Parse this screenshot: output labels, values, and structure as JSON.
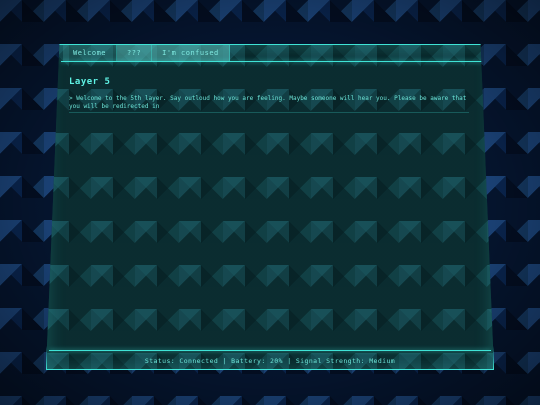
{
  "tabs": [
    {
      "label": "Welcome",
      "active": false
    },
    {
      "label": "???",
      "active": true
    },
    {
      "label": "I'm confused",
      "active": true
    }
  ],
  "main": {
    "heading": "Layer 5",
    "message": "> Welcome to the 5th layer. Say outloud how you are feeling. Maybe someone will hear you. Please be aware that you will be redirected in"
  },
  "status": {
    "text": "Status: Connected | Battery: 20% | Signal Strength: Medium"
  },
  "colors": {
    "accent": "#3fe3d6",
    "text": "#6ee7da",
    "screen": "#0f3a3c",
    "background": "#0a1630"
  }
}
